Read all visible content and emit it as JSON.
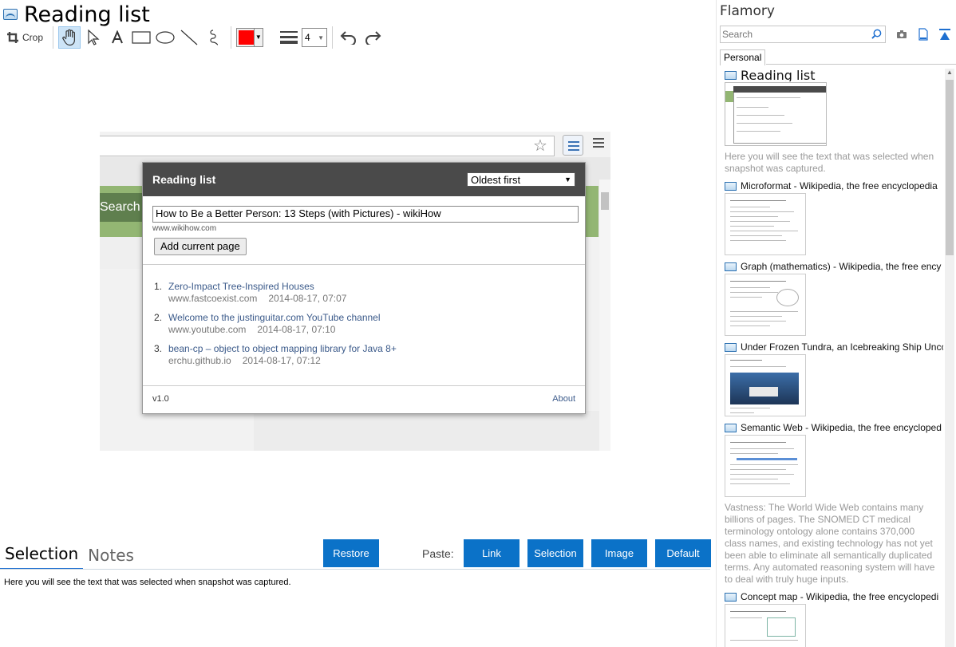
{
  "window": {
    "title": "Reading list"
  },
  "toolbar": {
    "crop_label": "Crop",
    "tools": [
      "hand-icon",
      "pointer-icon",
      "text-icon",
      "rectangle-icon",
      "ellipse-icon",
      "line-icon",
      "freehand-icon"
    ],
    "stroke_color": "#ff0000",
    "line_width": "4",
    "undo": "undo-icon",
    "redo": "redo-icon"
  },
  "snapshot": {
    "search_text": "Search",
    "popup": {
      "title": "Reading list",
      "sort_selected": "Oldest first",
      "current_title": "How to Be a Better Person: 13 Steps (with Pictures) - wikiHow",
      "current_host": "www.wikihow.com",
      "add_button": "Add current page",
      "items": [
        {
          "num": "1.",
          "title": "Zero-Impact Tree-Inspired Houses",
          "host": "www.fastcoexist.com",
          "date": "2014-08-17, 07:07"
        },
        {
          "num": "2.",
          "title": "Welcome to the justinguitar.com YouTube channel",
          "host": "www.youtube.com",
          "date": "2014-08-17, 07:10"
        },
        {
          "num": "3.",
          "title": "bean-cp – object to object mapping library for Java 8+",
          "host": "erchu.github.io",
          "date": "2014-08-17, 07:12"
        }
      ],
      "version": "v1.0",
      "about": "About"
    }
  },
  "bottom": {
    "tabs": [
      "Selection",
      "Notes"
    ],
    "restore_label": "Restore",
    "paste_label": "Paste:",
    "paste_buttons": [
      "Link",
      "Selection",
      "Image",
      "Default"
    ],
    "selection_text": "Here you will see the text that was selected when snapshot was captured."
  },
  "sidebar": {
    "brand": "Flamory",
    "search_placeholder": "Search",
    "tab": "Personal",
    "items": [
      {
        "title": "Reading list",
        "desc": "Here you will see the text that was selected when snapshot was captured."
      },
      {
        "title": "Microformat - Wikipedia, the free encyclopedia"
      },
      {
        "title": "Graph (mathematics) - Wikipedia, the free ency"
      },
      {
        "title": "Under Frozen Tundra, an Icebreaking Ship Unco"
      },
      {
        "title": "Semantic Web - Wikipedia, the free encycloped",
        "desc": "Vastness: The World Wide Web contains many billions of pages. The SNOMED CT medical terminology ontology alone contains 370,000 class names, and existing technology has not yet been able to eliminate all semantically duplicated terms. Any automated reasoning system will have to deal with truly huge inputs."
      },
      {
        "title": "Concept map - Wikipedia, the free encyclopedi"
      }
    ]
  }
}
